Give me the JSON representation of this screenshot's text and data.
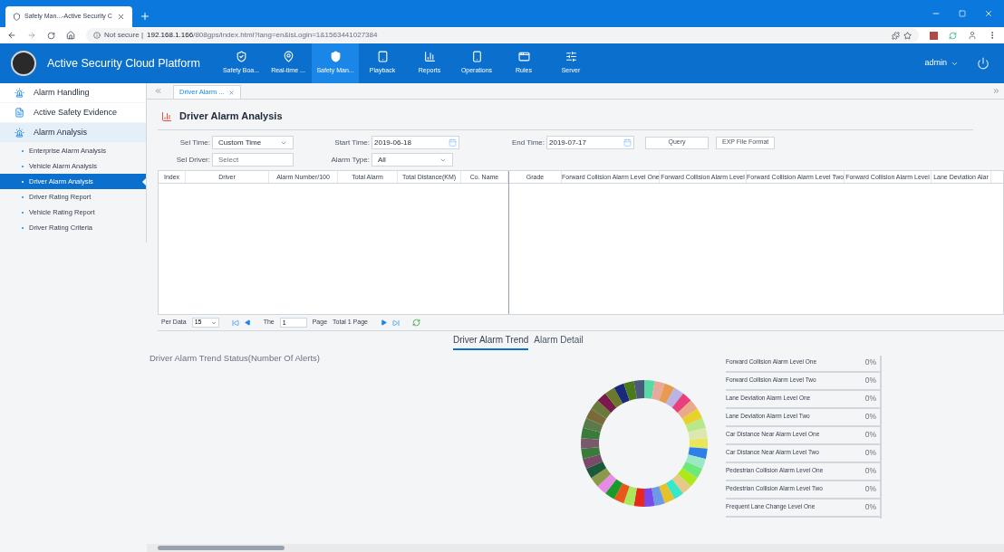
{
  "browser": {
    "tab_title": "Safety Man...-Active Security C",
    "security": "Not secure",
    "separator": "|",
    "url_host": "192.168.1.166",
    "url_path": "/808gps/index.html?lang=en&isLogin=1&1563441027384"
  },
  "header": {
    "title": "Active Security Cloud Platform",
    "user": "admin",
    "nav": [
      {
        "label": "Safety Boa...",
        "selected": false
      },
      {
        "label": "Real-time ...",
        "selected": false
      },
      {
        "label": "Safety Man...",
        "selected": true
      },
      {
        "label": "Playback",
        "selected": false
      },
      {
        "label": "Reports",
        "selected": false
      },
      {
        "label": "Operations",
        "selected": false
      },
      {
        "label": "Rules",
        "selected": false
      },
      {
        "label": "Server",
        "selected": false
      }
    ]
  },
  "sidebar": {
    "items": [
      {
        "label": "Alarm Handling",
        "expanded": false
      },
      {
        "label": "Active Safety Evidence",
        "expanded": false
      },
      {
        "label": "Alarm Analysis",
        "expanded": true,
        "children": [
          {
            "label": "Enterprise Alarm Analysis",
            "selected": false
          },
          {
            "label": "Vehicle Alarm Analysis",
            "selected": false
          },
          {
            "label": "Driver Alarm Analysis",
            "selected": true
          },
          {
            "label": "Driver Rating Report",
            "selected": false
          },
          {
            "label": "Vehicle Rating Report",
            "selected": false
          },
          {
            "label": "Driver Rating Criteria",
            "selected": false
          }
        ]
      }
    ]
  },
  "page_tabs": [
    {
      "label": "Driver Alarm ...",
      "selected": true
    }
  ],
  "page_title": "Driver Alarm Analysis",
  "filters": {
    "sel_time": {
      "label": "Sel Time:",
      "value": "Custom Time"
    },
    "start_time": {
      "label": "Start Time:",
      "value": "2019-06-18"
    },
    "end_time": {
      "label": "End Time:",
      "value": "2019-07-17"
    },
    "buttons": [
      "Query",
      "EXP File Format"
    ],
    "sel_driver": {
      "label": "Sel Driver:",
      "placeholder": "Select"
    },
    "alarm_type": {
      "label": "Alarm Type:",
      "value": "All"
    }
  },
  "table": {
    "frozen_columns": [
      "Index",
      "Driver",
      "Alarm Number/100",
      "Total Alarm",
      "Total Distance(KM)",
      "Co. Name"
    ],
    "columns": [
      "Grade",
      "Forward Collision Alarm Level One",
      "Forward Collision Alarm Level",
      "Forward Collision Alarm Level Two",
      "Forward Collision Alarm Level",
      "Lane Deviation Alar"
    ]
  },
  "pagination": {
    "per_data_label": "Per Data",
    "per_data_value": "15",
    "the_label": "The",
    "page_value": "1",
    "page_label": "Page",
    "total": "Total 1 Page"
  },
  "trend_tabs": [
    {
      "label": "Driver Alarm Trend",
      "selected": true
    },
    {
      "label": "Alarm Detail",
      "selected": false
    }
  ],
  "chart_title": "Driver Alarm Trend Status(Number Of Alerts)",
  "legend": [
    {
      "label": "Forward Collision Alarm Level One",
      "reading": "0%"
    },
    {
      "label": "Forward Collision Alarm Level Two",
      "reading": "0%"
    },
    {
      "label": "Lane Deviation Alarm Level One",
      "reading": "0%"
    },
    {
      "label": "Lane Deviation Alarm Level Two",
      "reading": "0%"
    },
    {
      "label": "Car Distance Near Alarm Level One",
      "reading": "0%"
    },
    {
      "label": "Car Distance Near Alarm Level Two",
      "reading": "0%"
    },
    {
      "label": "Pedestrian Collision Alarm Level One",
      "reading": "0%"
    },
    {
      "label": "Pedestrian Collision Alarm Level Two",
      "reading": "0%"
    },
    {
      "label": "Frequent Lane Change Level One",
      "reading": "0%"
    }
  ]
}
